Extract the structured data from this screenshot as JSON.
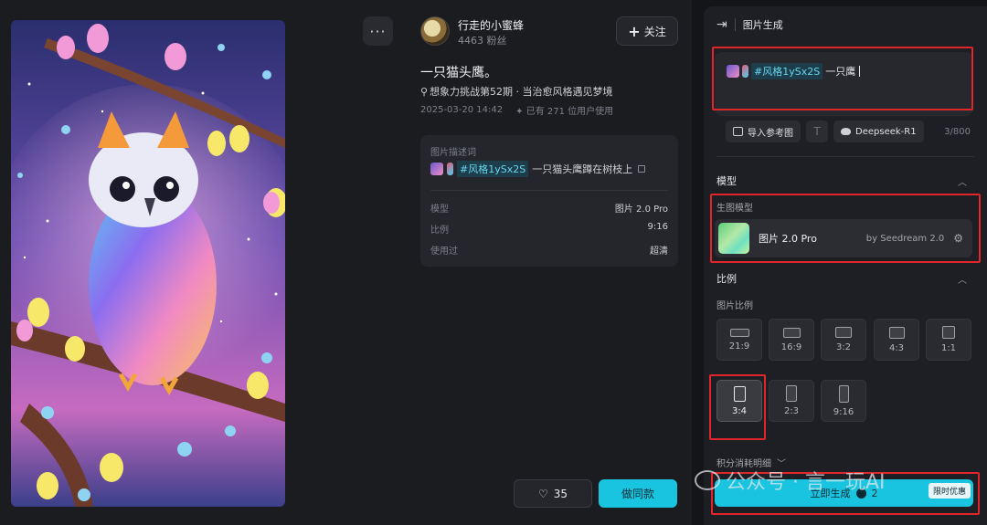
{
  "author": {
    "name": "行走的小蜜蜂",
    "fans": "4463 粉丝",
    "follow_label": "关注",
    "more_label": "···"
  },
  "work": {
    "title": "一只猫头鹰。",
    "challenge": "想象力挑战第52期 · 当治愈风格遇见梦境",
    "date": "2025-03-20 14:42",
    "used_by": "已有 271 位用户使用"
  },
  "info_card": {
    "desc_label": "图片描述词",
    "style_tag": "#风格1ySx2S",
    "desc_text": "一只猫头鹰蹲在树枝上",
    "rows": [
      {
        "key": "模型",
        "value": "图片 2.0 Pro"
      },
      {
        "key": "比例",
        "value": "9:16"
      },
      {
        "key": "使用过",
        "value": "超清"
      }
    ]
  },
  "actions": {
    "like_count": "35",
    "same_label": "做同款"
  },
  "panel": {
    "title": "图片生成",
    "prompt_style_tag": "#风格1ySx2S",
    "prompt_text": "一只鹰",
    "import_ref_label": "导入参考图",
    "text_icon": "T",
    "deepseek_label": "Deepseek-R1",
    "char_count": "3/800",
    "model_section": "模型",
    "gen_model_label": "生图模型",
    "model_name": "图片 2.0 Pro",
    "model_by": "by Seedream 2.0",
    "ratio_section": "比例",
    "ratio_label": "图片比例",
    "ratios": [
      {
        "label": "21:9",
        "active": false
      },
      {
        "label": "16:9",
        "active": false
      },
      {
        "label": "3:2",
        "active": false
      },
      {
        "label": "4:3",
        "active": false
      },
      {
        "label": "1:1",
        "active": false
      },
      {
        "label": "3:4",
        "active": true
      },
      {
        "label": "2:3",
        "active": false
      },
      {
        "label": "9:16",
        "active": false
      }
    ],
    "cost_detail": "积分消耗明细",
    "generate_label": "立即生成",
    "generate_cost": "2",
    "promo_badge": "限时优惠"
  },
  "watermark": {
    "text": "公众号 · 言一玩AI"
  },
  "colors": {
    "accent": "#18c4e0",
    "highlight_box": "#e1262b",
    "panel_bg": "#1e1f24"
  },
  "icons": [
    "more-icon",
    "plus-icon",
    "trophy-icon",
    "sparkle-icon",
    "copy-icon",
    "heart-icon",
    "collapse-panel-icon",
    "image-import-icon",
    "text-icon",
    "whale-icon",
    "chevron-up-icon",
    "sliders-icon",
    "chevron-down-icon",
    "coin-icon",
    "wechat-icon"
  ]
}
